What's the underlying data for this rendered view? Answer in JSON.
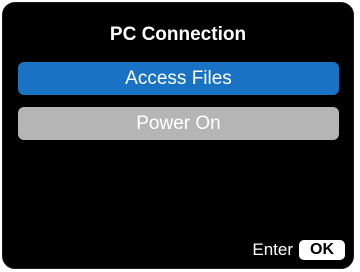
{
  "dialog": {
    "title": "PC Connection",
    "options": [
      {
        "label": "Access Files",
        "selected": true
      },
      {
        "label": "Power On",
        "selected": false
      }
    ]
  },
  "footer": {
    "enter_label": "Enter",
    "ok_label": "OK"
  },
  "colors": {
    "background": "#000000",
    "selected_item": "#1a72c4",
    "unselected_item": "#b5b5b5",
    "text": "#ffffff"
  }
}
